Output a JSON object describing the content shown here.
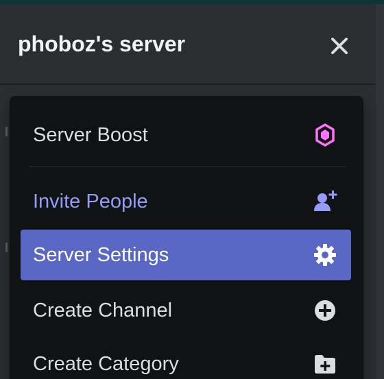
{
  "header": {
    "server_name": "phoboz's server",
    "close_icon": "close-icon"
  },
  "menu": {
    "items": [
      {
        "label": "Server Boost",
        "icon": "boost-gem-icon",
        "color": "#ff73fa"
      },
      {
        "label": "Invite People",
        "icon": "add-person-icon",
        "color": "#949cf7"
      },
      {
        "label": "Server Settings",
        "icon": "gear-icon",
        "active": true
      },
      {
        "label": "Create Channel",
        "icon": "plus-circle-icon"
      },
      {
        "label": "Create Category",
        "icon": "folder-plus-icon"
      }
    ]
  },
  "colors": {
    "background": "#2b2d31",
    "menu_background": "#111214",
    "active_item": "#5a67c4",
    "invite_text": "#949cf7",
    "boost_icon": "#ff73fa"
  }
}
